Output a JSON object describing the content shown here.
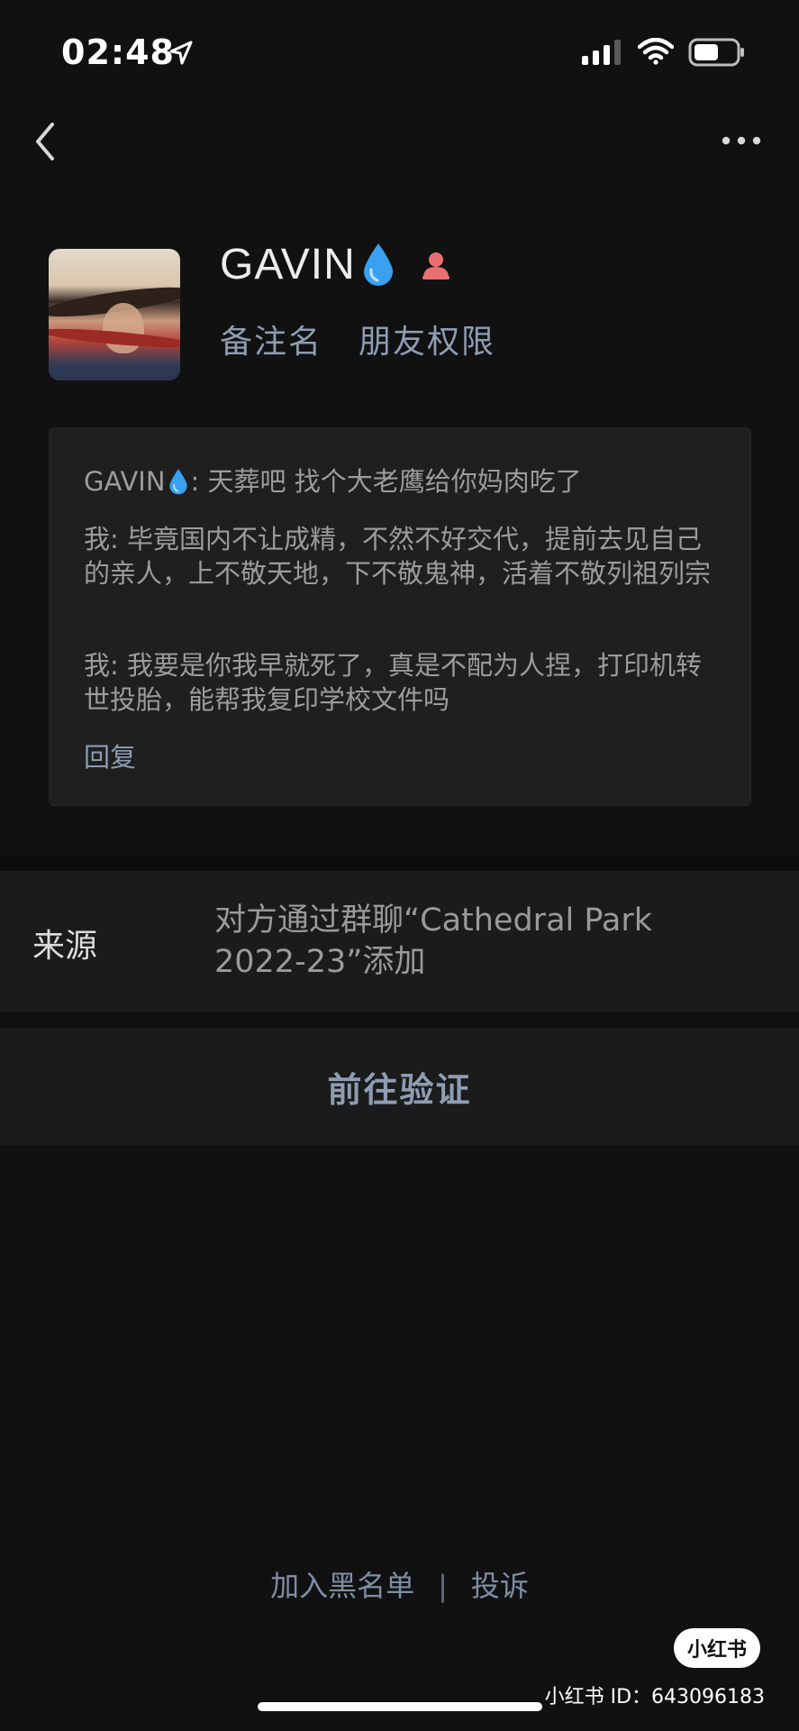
{
  "status_bar": {
    "time": "02:48",
    "icons": [
      "location-arrow-icon",
      "cellular-signal-icon",
      "wifi-icon",
      "battery-icon"
    ]
  },
  "nav": {
    "back_icon": "chevron-left-icon",
    "more_icon": "more-dots-icon"
  },
  "profile": {
    "name": "GAVIN",
    "name_emoji": "💧",
    "badge_icon": "person-icon",
    "links": {
      "remark": "备注名",
      "permissions": "朋友权限"
    }
  },
  "greeting": {
    "messages": [
      {
        "sender": "GAVIN",
        "sender_emoji": "💧",
        "text": ": 天葬吧 找个大老鹰给你妈肉吃了"
      },
      {
        "text": "我: 毕竟国内不让成精，不然不好交代，提前去见自己的亲人，上不敬天地，下不敬鬼神，活着不敬列祖列宗"
      },
      {
        "text": "我: 我要是你我早就死了，真是不配为人捏，打印机转世投胎，能帮我复印学校文件吗"
      }
    ],
    "reply": "回复"
  },
  "source": {
    "label": "来源",
    "value": "对方通过群聊“Cathedral Park 2022-23”添加"
  },
  "verify": {
    "label": "前往验证"
  },
  "bottom": {
    "blacklist": "加入黑名单",
    "separator": "|",
    "report": "投诉"
  },
  "watermark": {
    "logo": "小红书",
    "id_text": "小红书 ID：643096183"
  },
  "colors": {
    "background": "#111111",
    "link": "#8d9db3",
    "card": "#1f1f1f",
    "drop": "#3aa0f0",
    "badge": "#e8706f"
  }
}
